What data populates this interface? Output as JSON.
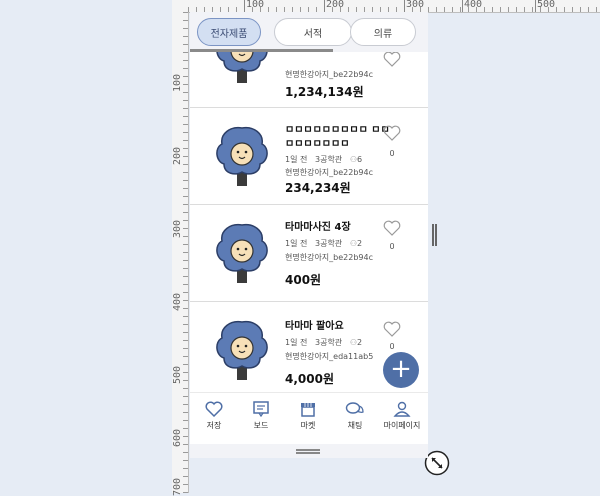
{
  "ruler": {
    "top_labels": [
      "100",
      "200",
      "300",
      "400",
      "500"
    ],
    "left_labels": [
      "100",
      "200",
      "300",
      "400",
      "500",
      "600",
      "700"
    ]
  },
  "tabs": [
    {
      "label": "전자제품",
      "active": true
    },
    {
      "label": "서적",
      "active": false
    },
    {
      "label": "의류",
      "active": false
    }
  ],
  "items": [
    {
      "title": "",
      "time": "",
      "place": "",
      "likes_count": "",
      "seller": "현명한강아지_be22b94c",
      "price": "1,234,134원",
      "heart_count": ""
    },
    {
      "title": "ㅁㅁㅁㅁㅁㅁㅁㅁㅁ ㅁㅁㅁㅁㅁㅁㅁㅁㅁ",
      "time": "1일 전",
      "place": "3공학관",
      "likes_count": "6",
      "seller": "현명한강아지_be22b94c",
      "price": "234,234원",
      "heart_count": "0"
    },
    {
      "title": "타마마사진 4장",
      "time": "1일 전",
      "place": "3공학관",
      "likes_count": "2",
      "seller": "현명한강아지_be22b94c",
      "price": "400원",
      "heart_count": "0"
    },
    {
      "title": "타마마 팔아요",
      "time": "1일 전",
      "place": "3공학관",
      "likes_count": "2",
      "seller": "현명한강아지_eda11ab5",
      "price": "4,000원",
      "heart_count": "0"
    }
  ],
  "fab": {
    "label": "+"
  },
  "bottom_nav": [
    {
      "label": "저장",
      "icon": "heart-icon"
    },
    {
      "label": "보드",
      "icon": "board-icon"
    },
    {
      "label": "마켓",
      "icon": "store-icon"
    },
    {
      "label": "채팅",
      "icon": "chat-icon"
    },
    {
      "label": "마이페이지",
      "icon": "person-icon"
    }
  ],
  "colors": {
    "accent": "#4f6fa6",
    "active_tab_bg": "#d3dff2",
    "avatar_blue": "#5c7bb5"
  }
}
